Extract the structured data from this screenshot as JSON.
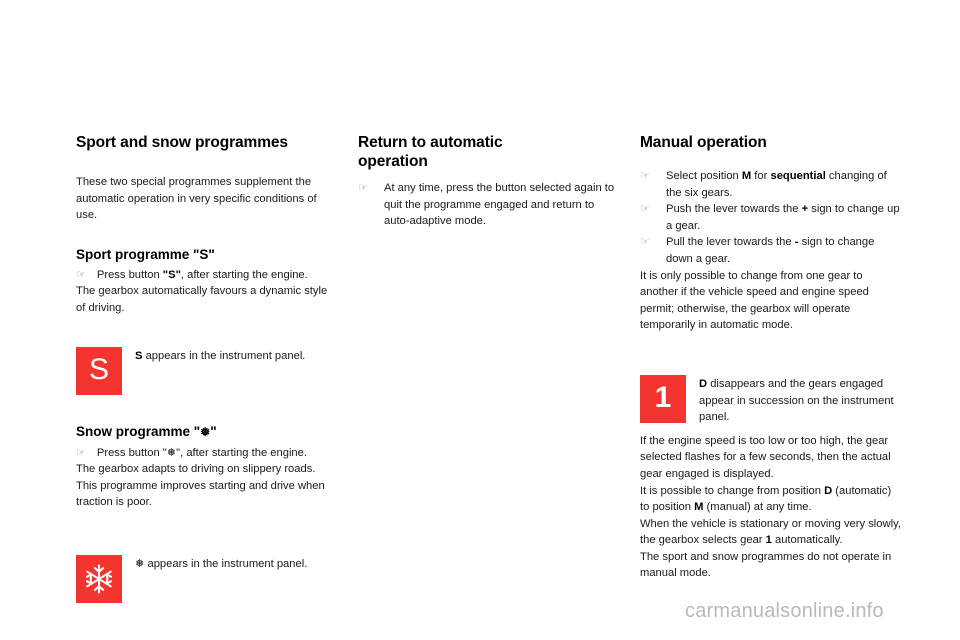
{
  "page": {
    "background": "#ffffff",
    "accent_red": "#f4352f",
    "bullet_glyph": "☞",
    "watermark": "carmanualsonline.info"
  },
  "left_column": {
    "title": "Sport and snow programmes",
    "intro": "These two special programmes supplement the automatic operation in very specific conditions of use.",
    "sport_heading": "Sport programme \"S\"",
    "sport_bullet_prefix": "Press button ",
    "sport_bullet_bold": "\"S\"",
    "sport_bullet_suffix": ", after starting the engine.",
    "sport_body": "The gearbox automatically favours a dynamic style of driving.",
    "sport_icon": {
      "icon_name": "sport-s-indicator-icon",
      "glyph": "S",
      "background": "#f4352f",
      "foreground": "#ffffff"
    },
    "sport_caption_bold": "S",
    "sport_caption_rest": " appears in the instrument panel.",
    "snow_heading_prefix": "Snow programme \"",
    "snow_heading_glyph": "❅",
    "snow_heading_suffix": "\"",
    "snow_bullet": "Press button \"❅\", after starting the engine.",
    "snow_body_1": "The gearbox adapts to driving on slippery roads.",
    "snow_body_2": "This programme improves starting and drive when traction is poor.",
    "snow_icon": {
      "icon_name": "snow-snowflake-indicator-icon",
      "glyph": "❅",
      "background": "#f4352f",
      "foreground": "#ffffff"
    },
    "snow_caption_glyph": "❅",
    "snow_caption_rest": " appears in the instrument panel."
  },
  "middle_column": {
    "title_line_1": "Return to automatic",
    "title_line_2": "operation",
    "bullets": [
      "At any time, press the button selected again to quit the programme engaged and return to auto-adaptive mode."
    ]
  },
  "right_column": {
    "title": "Manual operation",
    "bullet_1": {
      "part_1": "Select position ",
      "bold_1": "M",
      "part_2": " for ",
      "bold_2": "sequential",
      "part_3": " changing of the six gears."
    },
    "bullet_2": {
      "part_1": "Push the lever towards the ",
      "bold_1": "+",
      "part_2": " sign to change up a gear."
    },
    "bullet_3": {
      "part_1": "Pull the lever towards the ",
      "bold_1": "-",
      "part_2": " sign to change down a gear."
    },
    "body_1": "It is only possible to change from one gear to another if the vehicle speed and engine speed permit; otherwise, the gearbox will operate temporarily in automatic mode.",
    "gear_icon": {
      "icon_name": "gear-one-indicator-icon",
      "glyph": "1",
      "background": "#f4352f",
      "foreground": "#ffffff"
    },
    "gear_caption_bold": "D",
    "gear_caption_rest": " disappears and the gears engaged appear in succession on the instrument panel.",
    "body_2": "If the engine speed is too low or too high, the gear selected flashes for a few seconds, then the actual gear engaged is displayed.",
    "body_3": {
      "part_1": "It is possible to change from position ",
      "bold_1": "D",
      "part_2": " (automatic) to position ",
      "bold_2": "M",
      "part_3": " (manual) at any time."
    },
    "body_4": {
      "part_1": "When the vehicle is stationary or moving very slowly, the gearbox selects gear ",
      "bold_1": "1",
      "part_2": " automatically."
    },
    "body_5": "The sport and snow programmes do not operate in manual mode."
  }
}
